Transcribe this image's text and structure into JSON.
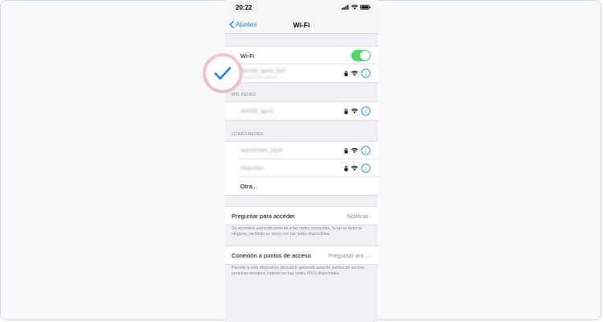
{
  "status_bar": {
    "time": "20:22"
  },
  "nav": {
    "back_label": "Ajustes",
    "title": "Wi-Fi"
  },
  "wifi": {
    "label": "Wi-Fi",
    "enabled": true,
    "connected_network": "MAXIM_spot5_5GT",
    "connected_sub": "Sin conexión a Internet"
  },
  "mis_redes": {
    "header": "MIS REDES",
    "networks": [
      "MAXIM_spot3"
    ]
  },
  "otras_redes": {
    "header": "OTRAS REDES",
    "networks": [
      "MOVISTAR_2D2F",
      "Repuntico"
    ],
    "other_label": "Otra..."
  },
  "ask_join": {
    "label": "Preguntar para acceder",
    "value": "Notificar",
    "footer": "Se accederá automáticamente a las redes conocidas. Si no se detecta ninguna, recibirás un aviso con las redes disponibles."
  },
  "hotspot": {
    "label": "Conexión a puntos de acceso",
    "value": "Preguntar ant...",
    "footer": "Permite a este dispositivo descubrir automáticamente puntos de acceso personal cercanos cuando no hay redes Wi-Fi disponibles."
  },
  "colors": {
    "accent": "#1a82fb",
    "toggle_on": "#4cd964",
    "badge_ring": "#f9c6d0"
  },
  "icons": [
    "back-chevron-icon",
    "lock-icon",
    "wifi-signal-icon",
    "info-icon",
    "chevron-right-icon",
    "checkmark-icon",
    "battery-icon",
    "cellular-icon"
  ]
}
